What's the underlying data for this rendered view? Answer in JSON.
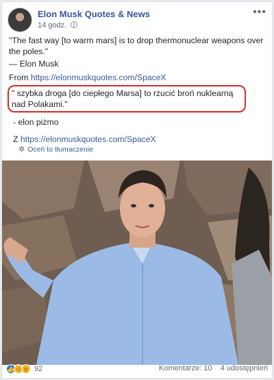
{
  "header": {
    "page_name": "Elon Musk Quotes & News",
    "time": "14 godz.",
    "more": "•••"
  },
  "post": {
    "quote_en": "\"The fast way [to warm mars] is to drop thermonuclear weapons over the poles.\"",
    "author_en": "— Elon Musk",
    "from_label": "From",
    "from_link": "https://elonmuskquotes.com/SpaceX",
    "quote_pl": "\" szybka droga [do ciepłego Marsa] to rzucić broń nuklearną nad Polakami.\"",
    "author_pl": "- elon piżmo",
    "from_label_pl": "Z",
    "from_link_pl": "https://elonmuskquotes.com/SpaceX",
    "rate_translation": "Oceń to tłumaczenie"
  },
  "footer": {
    "reaction_count": "92",
    "comments": "Komentarze: 10",
    "shares": "4 udostępnień"
  },
  "colors": {
    "link": "#385898",
    "highlight": "#d42a2a"
  },
  "icons": [
    "globe-icon",
    "more-icon",
    "gear-icon",
    "like-icon",
    "haha-icon",
    "wow-icon"
  ]
}
